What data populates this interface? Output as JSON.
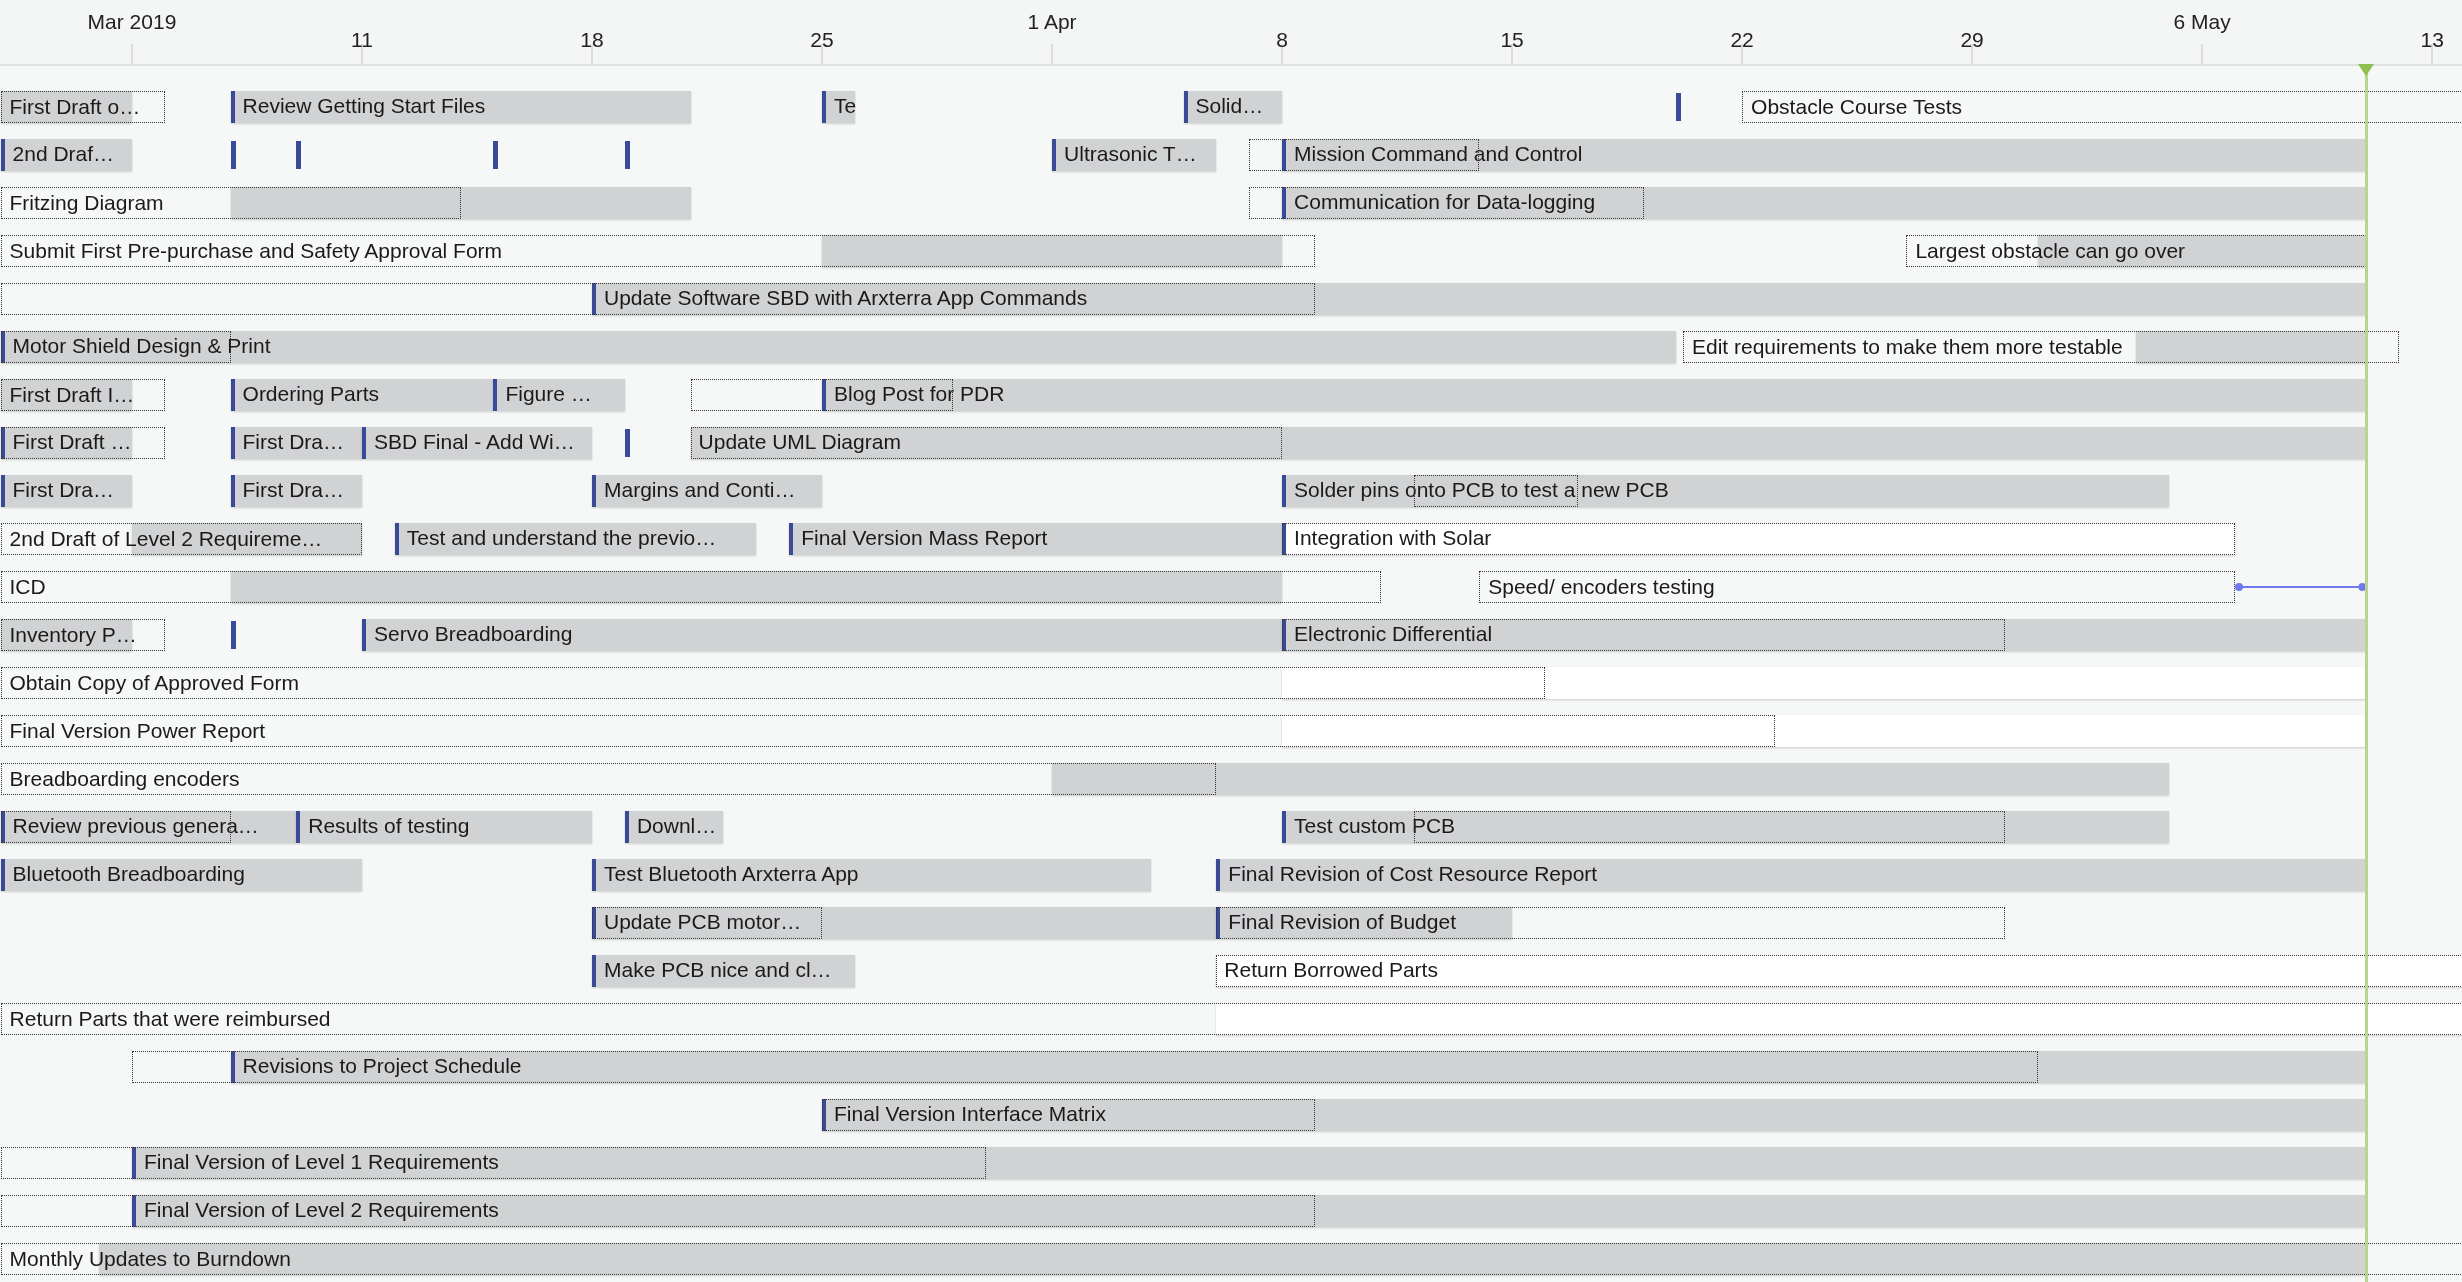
{
  "axis": [
    {
      "label": "Mar 2019",
      "major": true
    },
    {
      "label": "11",
      "major": false
    },
    {
      "label": "18",
      "major": false
    },
    {
      "label": "25",
      "major": false
    },
    {
      "label": "1 Apr",
      "major": true
    },
    {
      "label": "8",
      "major": false
    },
    {
      "label": "15",
      "major": false
    },
    {
      "label": "22",
      "major": false
    },
    {
      "label": "29",
      "major": false
    },
    {
      "label": "6 May",
      "major": true
    },
    {
      "label": "13",
      "major": false
    }
  ],
  "rows": [
    {
      "bars": [
        {
          "kind": "actual",
          "marker": false
        },
        {
          "kind": "planned",
          "label": "First Draft o…"
        },
        {
          "kind": "actual",
          "marker": true,
          "label": "Review Getting Start Files"
        },
        {
          "kind": "actual",
          "marker": true,
          "label": "Te"
        },
        {
          "kind": "actual",
          "marker": true,
          "label": "Solid…"
        },
        {
          "kind": "milestone"
        },
        {
          "kind": "planned",
          "label": "Obstacle Course Tests"
        }
      ]
    },
    {
      "bars": [
        {
          "kind": "actual",
          "marker": true,
          "label": "2nd Draf…"
        },
        {
          "kind": "milestone"
        },
        {
          "kind": "milestone"
        },
        {
          "kind": "milestone"
        },
        {
          "kind": "milestone"
        },
        {
          "kind": "actual",
          "marker": true,
          "label": "Ultrasonic T…"
        },
        {
          "kind": "actual",
          "marker": true,
          "label": "Mission Command and Control"
        },
        {
          "kind": "planned"
        }
      ]
    },
    {
      "bars": [
        {
          "kind": "actual",
          "marker": false
        },
        {
          "kind": "planned",
          "label": "Fritzing Diagram"
        },
        {
          "kind": "actual",
          "marker": true,
          "label": "Communication for Data-logging"
        },
        {
          "kind": "planned"
        }
      ]
    },
    {
      "bars": [
        {
          "kind": "actual",
          "marker": false
        },
        {
          "kind": "planned",
          "label": "Submit First Pre-purchase and Safety Approval Form"
        },
        {
          "kind": "actual",
          "marker": false
        },
        {
          "kind": "planned",
          "label": "Largest obstacle can go over"
        }
      ]
    },
    {
      "bars": [
        {
          "kind": "actual",
          "marker": true,
          "label": "Update Software SBD with Arxterra App Commands"
        },
        {
          "kind": "planned"
        }
      ]
    },
    {
      "bars": [
        {
          "kind": "actual",
          "marker": true,
          "label": "Motor Shield Design & Print"
        },
        {
          "kind": "planned"
        },
        {
          "kind": "actual",
          "marker": false
        },
        {
          "kind": "planned",
          "label": "Edit requirements to make them more testable"
        }
      ]
    },
    {
      "bars": [
        {
          "kind": "actual",
          "marker": false
        },
        {
          "kind": "planned",
          "label": "First Draft I…"
        },
        {
          "kind": "actual",
          "marker": true,
          "label": "Ordering Parts"
        },
        {
          "kind": "actual",
          "marker": true,
          "label": "Figure …"
        },
        {
          "kind": "actual",
          "marker": true,
          "label": "Blog Post for PDR"
        },
        {
          "kind": "planned"
        }
      ]
    },
    {
      "bars": [
        {
          "kind": "actual",
          "marker": true,
          "label": "First Draft …"
        },
        {
          "kind": "planned"
        },
        {
          "kind": "actual",
          "marker": true,
          "label": "First Dra…"
        },
        {
          "kind": "actual",
          "marker": true,
          "label": "SBD Final - Add Wi…"
        },
        {
          "kind": "milestone"
        },
        {
          "kind": "actual",
          "marker": false,
          "label": "Update UML Diagram"
        },
        {
          "kind": "planned"
        }
      ]
    },
    {
      "bars": [
        {
          "kind": "actual",
          "marker": true,
          "label": "First Dra…"
        },
        {
          "kind": "actual",
          "marker": true,
          "label": "First Dra…"
        },
        {
          "kind": "actual",
          "marker": true,
          "label": "Margins and Conti…"
        },
        {
          "kind": "actual",
          "marker": true,
          "label": "Solder pins onto PCB to test a new PCB"
        },
        {
          "kind": "planned"
        }
      ]
    },
    {
      "bars": [
        {
          "kind": "actual",
          "marker": false
        },
        {
          "kind": "planned",
          "label": "2nd Draft of Level 2 Requireme…"
        },
        {
          "kind": "actual",
          "marker": true,
          "label": "Test and understand the previo…"
        },
        {
          "kind": "actual",
          "marker": true,
          "label": "Final Version Mass Report"
        },
        {
          "kind": "white",
          "marker": true,
          "label": "Integration with Solar"
        },
        {
          "kind": "planned"
        }
      ]
    },
    {
      "bars": [
        {
          "kind": "actual",
          "marker": false
        },
        {
          "kind": "planned",
          "label": "ICD"
        },
        {
          "kind": "planned",
          "label": "Speed/ encoders testing"
        },
        {
          "kind": "link"
        }
      ]
    },
    {
      "bars": [
        {
          "kind": "actual",
          "marker": false
        },
        {
          "kind": "planned",
          "label": "Inventory P…"
        },
        {
          "kind": "milestone"
        },
        {
          "kind": "actual",
          "marker": true,
          "label": "Servo Breadboarding"
        },
        {
          "kind": "actual",
          "marker": true,
          "label": "Electronic Differential"
        },
        {
          "kind": "planned"
        }
      ]
    },
    {
      "bars": [
        {
          "kind": "white",
          "marker": false
        },
        {
          "kind": "planned",
          "label": "Obtain Copy of Approved Form"
        }
      ]
    },
    {
      "bars": [
        {
          "kind": "white",
          "marker": false
        },
        {
          "kind": "planned",
          "label": "Final Version Power Report"
        }
      ]
    },
    {
      "bars": [
        {
          "kind": "actual",
          "marker": false
        },
        {
          "kind": "planned",
          "label": "Breadboarding encoders"
        }
      ]
    },
    {
      "bars": [
        {
          "kind": "actual",
          "marker": true,
          "label": "Review previous genera…"
        },
        {
          "kind": "planned"
        },
        {
          "kind": "actual",
          "marker": true,
          "label": "Results of testing"
        },
        {
          "kind": "actual",
          "marker": true,
          "label": "Downl…"
        },
        {
          "kind": "actual",
          "marker": true,
          "label": "Test custom PCB"
        },
        {
          "kind": "planned"
        }
      ]
    },
    {
      "bars": [
        {
          "kind": "actual",
          "marker": true,
          "label": "Bluetooth Breadboarding"
        },
        {
          "kind": "actual",
          "marker": true,
          "label": "Test Bluetooth Arxterra App"
        },
        {
          "kind": "actual",
          "marker": true,
          "label": "Final Revision of Cost Resource Report"
        }
      ]
    },
    {
      "bars": [
        {
          "kind": "actual",
          "marker": true,
          "label": "Update PCB motor…"
        },
        {
          "kind": "planned"
        },
        {
          "kind": "actual",
          "marker": true,
          "label": "Final Revision of Budget"
        },
        {
          "kind": "planned"
        }
      ]
    },
    {
      "bars": [
        {
          "kind": "actual",
          "marker": true,
          "label": "Make PCB nice and cl…"
        },
        {
          "kind": "white",
          "marker": false,
          "label": "Return Borrowed Parts"
        },
        {
          "kind": "planned"
        }
      ]
    },
    {
      "bars": [
        {
          "kind": "white",
          "marker": false
        },
        {
          "kind": "planned",
          "label": "Return Parts that were reimbursed"
        }
      ]
    },
    {
      "bars": [
        {
          "kind": "actual",
          "marker": true,
          "label": "Revisions to Project Schedule"
        },
        {
          "kind": "planned"
        }
      ]
    },
    {
      "bars": [
        {
          "kind": "actual",
          "marker": true,
          "label": "Final Version Interface Matrix"
        },
        {
          "kind": "planned"
        }
      ]
    },
    {
      "bars": [
        {
          "kind": "actual",
          "marker": true,
          "label": "Final Version of Level 1 Requirements"
        },
        {
          "kind": "planned"
        }
      ]
    },
    {
      "bars": [
        {
          "kind": "actual",
          "marker": true,
          "label": "Final Version of Level 2 Requirements"
        },
        {
          "kind": "planned"
        }
      ]
    },
    {
      "bars": [
        {
          "kind": "actual",
          "marker": false
        },
        {
          "kind": "planned",
          "label": "Monthly Updates to Burndown"
        }
      ]
    }
  ]
}
